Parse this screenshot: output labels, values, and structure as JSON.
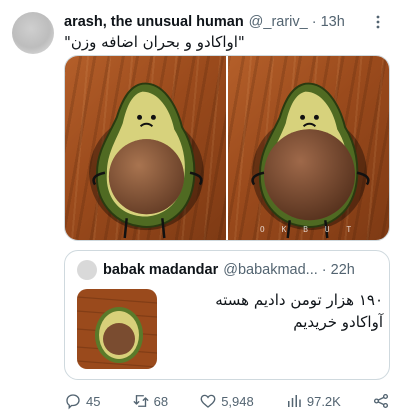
{
  "tweet": {
    "display_name": "arash, the unusual human",
    "handle": "@_rariv_",
    "separator": "·",
    "time": "13h",
    "text": "\"اواکادو و بحران اضافه وزن\"",
    "watermark": "O K B U T"
  },
  "quoted": {
    "display_name": "babak madandar",
    "handle": "@babakmad...",
    "separator": "·",
    "time": "22h",
    "text": "۱۹۰ هزار تومن دادیم هسته آواکادو خریدیم"
  },
  "actions": {
    "reply_count": "45",
    "retweet_count": "68",
    "like_count": "5,948",
    "view_count": "97.2K"
  },
  "colors": {
    "text_primary": "#0f1419",
    "text_secondary": "#536471",
    "border": "#cfd9de",
    "wood": "#9a4a1c",
    "avocado_skin": "#5f7a2a",
    "avocado_flesh": "#d8d07a",
    "pit": "#8a5a3a"
  },
  "icons": [
    "more-icon",
    "reply-icon",
    "retweet-icon",
    "like-icon",
    "views-icon",
    "share-icon"
  ]
}
